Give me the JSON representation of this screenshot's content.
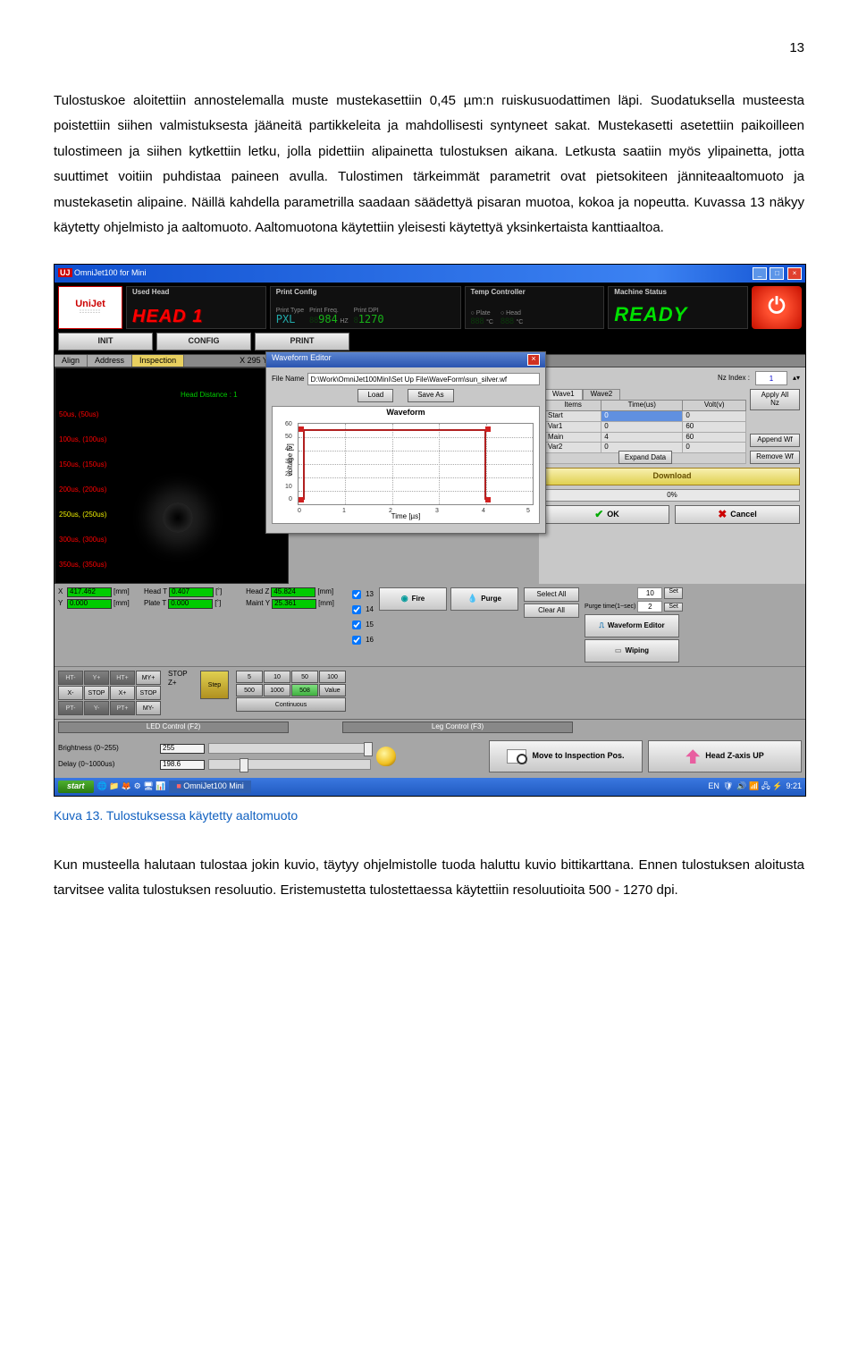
{
  "page_number": "13",
  "paragraph1": "Tulostuskoe aloitettiin annostelemalla muste mustekasettiin 0,45 µm:n ruiskusuodattimen läpi. Suodatuksella musteesta poistettiin siihen valmistuksesta jääneitä partikkeleita ja mahdollisesti syntyneet sakat. Mustekasetti asetettiin paikoilleen tulostimeen ja siihen kytkettiin letku, jolla pidettiin alipainetta tulostuksen aikana. Letkusta saatiin myös ylipainetta, jotta suuttimet voitiin puhdistaa paineen avulla. Tulostimen tärkeimmät parametrit ovat pietsokiteen jänniteaaltomuoto ja mustekasetin alipaine. Näillä kahdella parametrilla saadaan säädettyä pisaran muotoa, kokoa ja nopeutta. Kuvassa 13 näkyy käytetty ohjelmisto ja aaltomuoto. Aaltomuotona käytettiin yleisesti käytettyä yksinkertaista kanttiaaltoa.",
  "caption": "Kuva 13. Tulostuksessa käytetty aaltomuoto",
  "paragraph2": "Kun musteella halutaan tulostaa jokin kuvio, täytyy ohjelmistolle tuoda haluttu kuvio bittikarttana. Ennen tulostuksen aloitusta tarvitsee valita tulostuksen resoluutio. Eristemustetta tulostettaessa käytettiin resoluutioita 500 - 1270 dpi.",
  "app": {
    "window_title": "OmniJet100 for Mini",
    "logo": "UniJet",
    "header": {
      "used_head_label": "Used Head",
      "used_head_value": "HEAD 1",
      "print_config_label": "Print Config",
      "print_type_label": "Print Type",
      "print_type_value": "PXL",
      "print_freq_label": "Print Freq.",
      "print_freq_value": "984",
      "print_freq_unit": "HZ",
      "print_dpi_label": "Print DPI",
      "print_dpi_value": "1270",
      "temp_label": "Temp Controller",
      "plate_label": "Plate",
      "plate_temp": "888",
      "head_label": "Head",
      "head_temp": "888",
      "unit_c": "°C",
      "machine_status_label": "Machine Status",
      "machine_status_value": "READY"
    },
    "mainbtns": {
      "init": "INIT",
      "config": "CONFIG",
      "print": "PRINT"
    },
    "tabs": {
      "align": "Align",
      "address": "Address",
      "inspection": "Inspection",
      "coords": "X 295  Y 0"
    },
    "cam": {
      "hd": "Head Distance : 1",
      "l1": "50us, (50us)",
      "l2": "100us, (100us)",
      "l3": "150us, (150us)",
      "l4": "200us, (200us)",
      "l5": "250us, (250us)",
      "l6": "300us, (300us)",
      "l7": "350us, (350us)"
    },
    "wf_editor": {
      "title": "Waveform Editor",
      "filename_label": "File Name",
      "filename": "D:\\Work\\OmniJet100Mini\\Set Up File\\WaveForm\\sun_silver.wf",
      "load": "Load",
      "saveas": "Save As"
    },
    "right_col": {
      "nzindex_label": "Nz Index :",
      "nzindex": "1",
      "wave1": "Wave1",
      "wave2": "Wave2",
      "apply": "Apply  All Nz",
      "th_items": "Items",
      "th_time": "Time(us)",
      "th_volt": "Volt(v)",
      "r1": "Start",
      "r1t": "0",
      "r1v": "0",
      "r2": "Var1",
      "r2t": "0",
      "r2v": "60",
      "r3": "Main",
      "r3t": "4",
      "r3v": "60",
      "r4": "Var2",
      "r4t": "0",
      "r4v": "0",
      "expand": "Expand Data",
      "append": "Append Wf",
      "remove": "Remove Wf",
      "download": "Download",
      "progress": "0%",
      "ok": "OK",
      "cancel": "Cancel"
    },
    "readouts": {
      "x": "X",
      "xv": "417.462",
      "mm": "[mm]",
      "y": "Y",
      "yv": "0.000",
      "ht": "Head T",
      "htv": "0.407",
      "deg": "[˚]",
      "pt": "Plate T",
      "ptv": "0.000",
      "hz": "Head Z",
      "hzv": "45.824",
      "my": "Maint Y",
      "myv": "25.361"
    },
    "pads": {
      "ht_minus": "HT-",
      "y_plus": "Y+",
      "ht_plus": "HT+",
      "my_plus": "MY+",
      "x_minus": "X-",
      "stop": "STOP",
      "x_plus": "X+",
      "stop2": "STOP",
      "stop3": "STOP",
      "pt_minus": "PT-",
      "y_minus": "Y-",
      "pt_plus": "PT+",
      "my_minus": "MY-",
      "z_plus": "Z+",
      "step": "Step",
      "s5": "5",
      "s10": "10",
      "s50": "50",
      "s100": "100",
      "s500": "500",
      "s1000": "1000",
      "s508": "508",
      "sval": "Value",
      "continuous": "Continuous"
    },
    "noz": {
      "n13": "13",
      "n14": "14",
      "n15": "15",
      "n16": "16"
    },
    "fp": {
      "fire": "Fire",
      "purge": "Purge",
      "selall": "Select All",
      "clrall": "Clear All"
    },
    "rbtns": {
      "wfe": "Waveform Editor",
      "wipe": "Wiping",
      "purgetime": "Purge time(1~sec)",
      "purgev": "2",
      "set": "Set",
      "topv": "10"
    },
    "led": {
      "led_title": "LED Control (F2)",
      "leg_title": "Leg Control (F3)",
      "bright_label": "Brightness (0~255)",
      "bright_v": "255",
      "delay_label": "Delay (0~1000us)",
      "delay_v": "198.6",
      "insp": "Move to Inspection Pos.",
      "zup": "Head Z-axis UP"
    },
    "taskbar": {
      "start": "start",
      "task": "OmniJet100 Mini",
      "lang": "EN",
      "time": "9:21"
    }
  },
  "chart_data": {
    "type": "line",
    "title": "Waveform",
    "xlabel": "Time [µs]",
    "ylabel": "voltage [v]",
    "x_ticks": [
      0,
      1,
      2,
      3,
      4,
      5
    ],
    "y_ticks": [
      0,
      10,
      20,
      30,
      40,
      50,
      60
    ],
    "xlim": [
      0,
      5
    ],
    "ylim": [
      0,
      60
    ],
    "series": [
      {
        "name": "waveform",
        "x": [
          0,
          0,
          4,
          4
        ],
        "y": [
          0,
          60,
          60,
          0
        ]
      }
    ]
  }
}
